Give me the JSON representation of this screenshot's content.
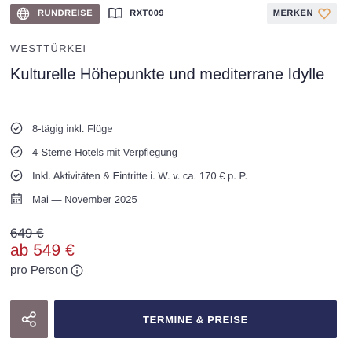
{
  "tour_badge": {
    "label": "RUNDREISE",
    "icon": "globe-icon",
    "background": "#7a6a6f"
  },
  "tour_code": {
    "label": "RXT009",
    "icon": "book-icon"
  },
  "bookmark": {
    "label": "MERKEN",
    "icon": "heart-icon",
    "icon_color": "#e0a05a"
  },
  "region": "WESTTÜRKEI",
  "title": "Kulturelle Höhepunkte und mediterrane Idylle",
  "features": [
    {
      "icon": "check-circle-icon",
      "text": "8-tägig inkl. Flüge"
    },
    {
      "icon": "check-circle-icon",
      "text": "4-Sterne-Hotels mit Verpflegung"
    },
    {
      "icon": "check-circle-icon",
      "text": "Inkl. Aktivitäten & Eintritte i. W. v. ca. 170 € p. P."
    },
    {
      "icon": "calendar-icon",
      "text": "Mai — November 2025"
    }
  ],
  "price": {
    "old": "649 €",
    "new": "ab 549 €",
    "new_color": "#b3202a",
    "per_person": "pro Person",
    "info_icon": "info-icon"
  },
  "actions": {
    "share_icon": "share-icon",
    "cta_label": "TERMINE & PREISE",
    "cta_color": "#272b57"
  }
}
